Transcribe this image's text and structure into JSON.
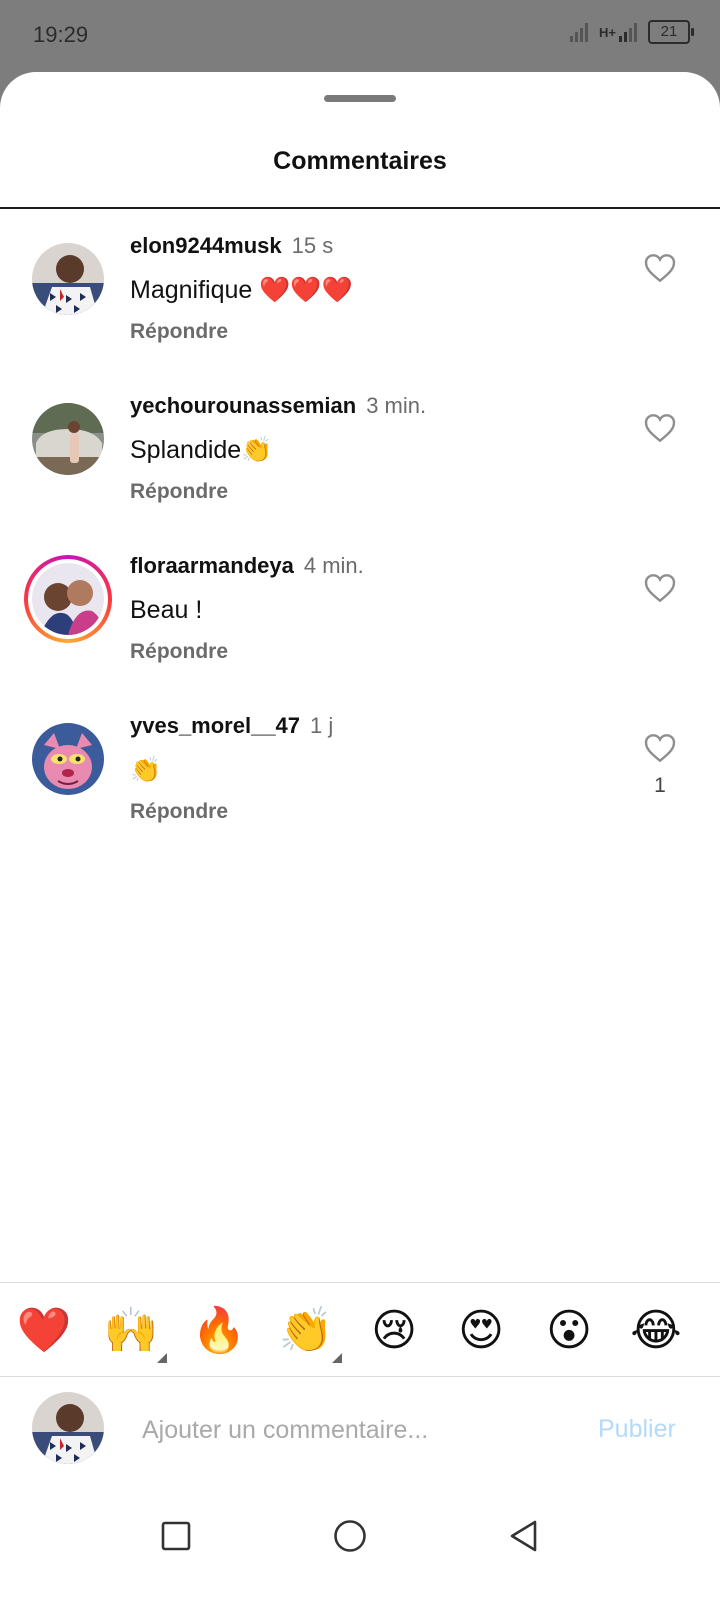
{
  "status_bar": {
    "time": "19:29",
    "network": "H+",
    "battery": "21"
  },
  "sheet": {
    "title": "Commentaires"
  },
  "comments": [
    {
      "username": "elon9244musk",
      "time": "15 s",
      "text": "Magnifique ❤️❤️❤️",
      "reply_label": "Répondre",
      "likes": ""
    },
    {
      "username": "yechourounassemian",
      "time": "3 min.",
      "text": "Splandide👏",
      "reply_label": "Répondre",
      "likes": ""
    },
    {
      "username": "floraarmandeya",
      "time": "4 min.",
      "text": "Beau !",
      "reply_label": "Répondre",
      "likes": ""
    },
    {
      "username": "yves_morel__47",
      "time": "1 j",
      "text": "👏",
      "reply_label": "Répondre",
      "likes": "1"
    }
  ],
  "emoji_bar": [
    "❤️",
    "🙌",
    "🔥",
    "👏",
    "😢",
    "😍",
    "😮",
    "😂"
  ],
  "composer": {
    "placeholder": "Ajouter un commentaire...",
    "publish_label": "Publier"
  },
  "colors": {
    "accent_disabled": "#b4dafb",
    "status_background": "#7d7d7d",
    "story_ring": "#c913b9"
  }
}
